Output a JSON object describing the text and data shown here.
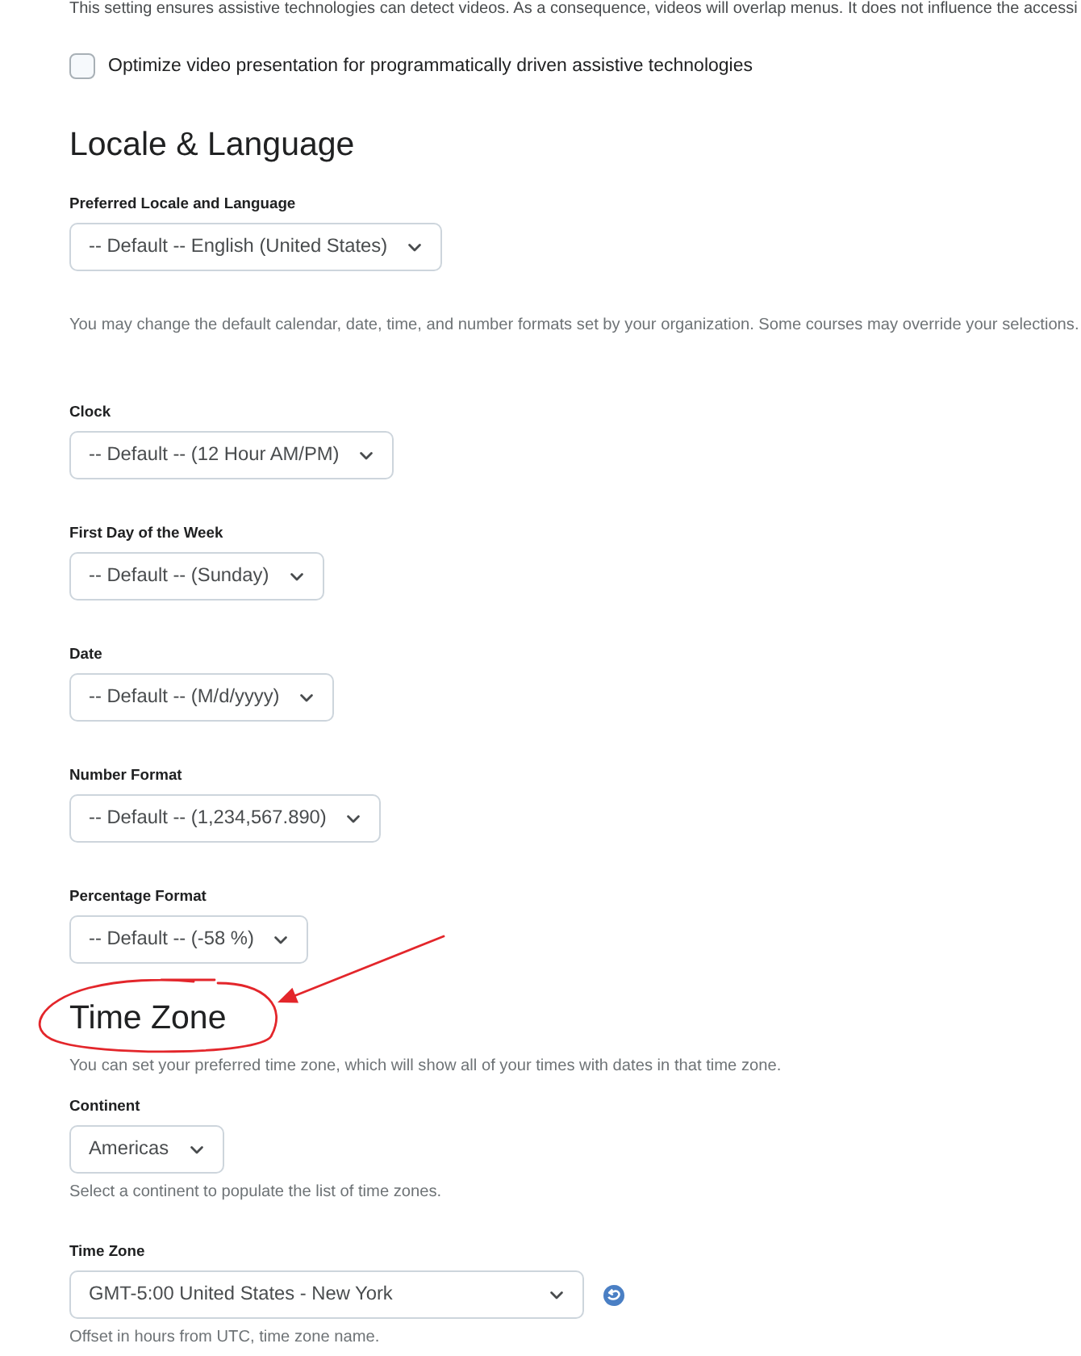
{
  "intro_text": "This setting ensures assistive technologies can detect videos. As a consequence, videos will overlap menus. It does not influence the accessi",
  "video_option": {
    "label": "Optimize video presentation for programmatically driven assistive technologies",
    "checked": false
  },
  "sections": [
    {
      "title": "Locale & Language",
      "circled": false,
      "items": [
        {
          "kind": "select",
          "label": "Preferred Locale and Language",
          "value": "-- Default -- English (United States)"
        },
        {
          "kind": "note",
          "text": "You may change the default calendar, date, time, and number formats set by your organization. Some courses may override your selections."
        },
        {
          "kind": "select",
          "label": "Clock",
          "value": "-- Default -- (12 Hour AM/PM)"
        },
        {
          "kind": "select",
          "label": "First Day of the Week",
          "value": "-- Default -- (Sunday)"
        },
        {
          "kind": "select",
          "label": "Date",
          "value": "-- Default -- (M/d/yyyy)"
        },
        {
          "kind": "select",
          "label": "Number Format",
          "value": "-- Default -- (1,234,567.890)"
        },
        {
          "kind": "select",
          "label": "Percentage Format",
          "value": "-- Default -- (-58 %)"
        }
      ]
    },
    {
      "title": "Time Zone",
      "circled": true,
      "items": [
        {
          "kind": "note",
          "text": "You can set your preferred time zone, which will show all of your times with dates in that time zone."
        },
        {
          "kind": "select",
          "label": "Continent",
          "value": "Americas"
        },
        {
          "kind": "hint",
          "text": "Select a continent to populate the list of time zones."
        },
        {
          "kind": "timezone_select",
          "label": "Time Zone",
          "value": "GMT-5:00 United States - New York"
        },
        {
          "kind": "hint",
          "text": "Offset in hours from UTC, time zone name."
        }
      ]
    }
  ]
}
